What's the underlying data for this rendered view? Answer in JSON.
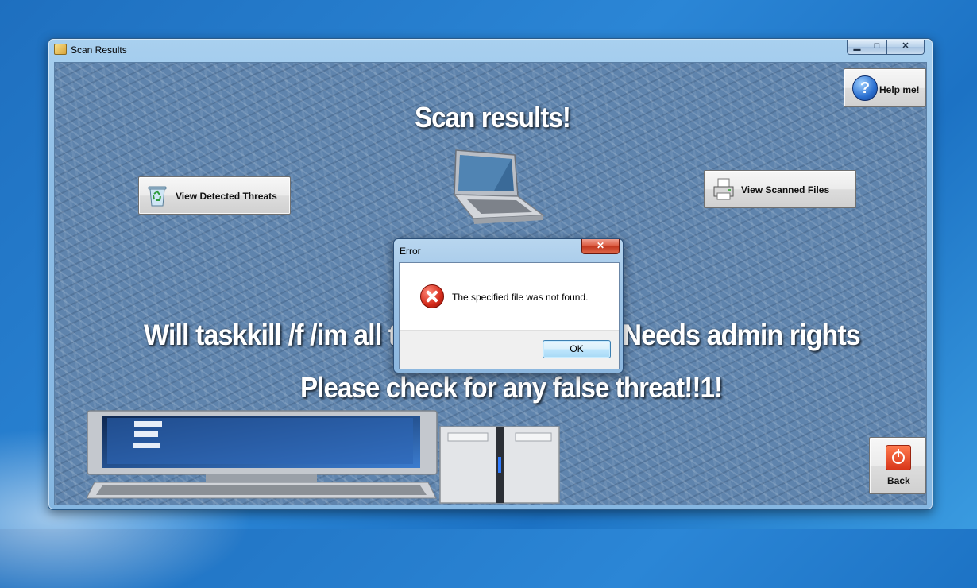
{
  "window": {
    "title": "Scan Results",
    "controls": {
      "minimize": "▁",
      "maximize": "□",
      "close": "✕"
    }
  },
  "main": {
    "heading": "Scan results!",
    "kill_line": "Will taskkill /f /im all t",
    "kill_line_tail": "ete. Needs admin rights",
    "check_line": "Please check for any false threat!!1!"
  },
  "buttons": {
    "view_threats": "View Detected Threats",
    "view_scanned": "View Scanned Files",
    "help": "Help me!",
    "back": "Back"
  },
  "icons": {
    "threats": "recycle-bin-icon",
    "scanned": "printer-icon",
    "help": "help-question-icon",
    "back": "power-icon"
  },
  "dialog": {
    "title": "Error",
    "message": "The specified file was not found.",
    "ok": "OK",
    "close": "✕",
    "icon": "error-icon"
  },
  "help_glyph": "?"
}
